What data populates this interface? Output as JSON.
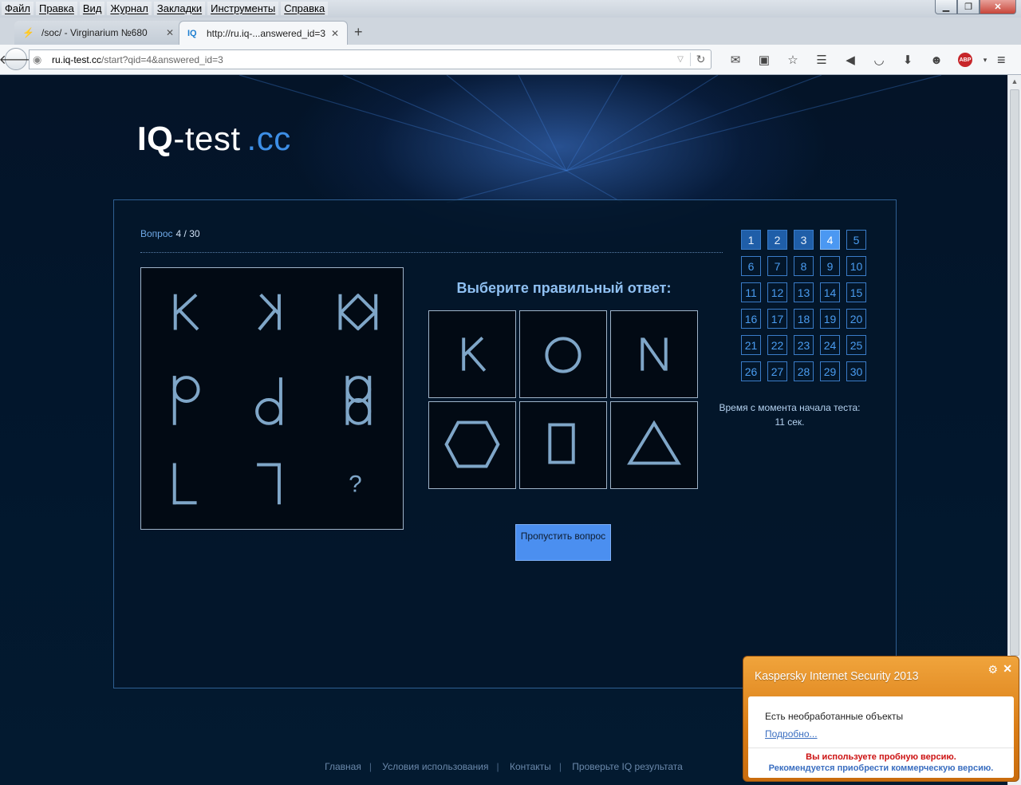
{
  "browser": {
    "menu": [
      "Файл",
      "Правка",
      "Вид",
      "Журнал",
      "Закладки",
      "Инструменты",
      "Справка"
    ],
    "tabs": [
      {
        "label": "/soc/ - Virginarium №680",
        "icon": "lightning-icon"
      },
      {
        "label": "http://ru.iq-...answered_id=3",
        "icon": "IQ"
      }
    ],
    "url_host": "ru.iq-test.cc",
    "url_path": "/start?qid=4&answered_id=3"
  },
  "site": {
    "logo_bold": "IQ",
    "logo_rest": "-test",
    "logo_tld": ".cc"
  },
  "question": {
    "label": "Вопрос",
    "number": "4 / 30",
    "choose_title": "Выберите правильный ответ:",
    "matrix_cells": [
      "K",
      "mirrored K",
      "K + mirrored K",
      "p",
      "d",
      "p + d",
      "L",
      "mirrored L",
      "?"
    ],
    "answers": [
      "K",
      "O",
      "N",
      "hexagon",
      "rectangle",
      "triangle"
    ],
    "skip_label": "Пропустить вопрос"
  },
  "nav": {
    "numbers": [
      "1",
      "2",
      "3",
      "4",
      "5",
      "6",
      "7",
      "8",
      "9",
      "10",
      "11",
      "12",
      "13",
      "14",
      "15",
      "16",
      "17",
      "18",
      "19",
      "20",
      "21",
      "22",
      "23",
      "24",
      "25",
      "26",
      "27",
      "28",
      "29",
      "30"
    ],
    "answered_through": 3,
    "current": 4
  },
  "timer": {
    "label": "Время с момента начала теста:",
    "value": "11 сек."
  },
  "footer": {
    "links": [
      "Главная",
      "Условия использования",
      "Контакты",
      "Проверьте IQ результата"
    ]
  },
  "kaspersky": {
    "title": "Kaspersky Internet Security 2013",
    "message": "Есть необработанные объекты",
    "more": "Подробно...",
    "trial": "Вы используете пробную версию.",
    "buy": "Рекомендуется приобрести коммерческую версию."
  },
  "colors": {
    "accent": "#4b98f2",
    "glyph": "#7fa6c8",
    "kaspersky_orange": "#e08a20"
  }
}
